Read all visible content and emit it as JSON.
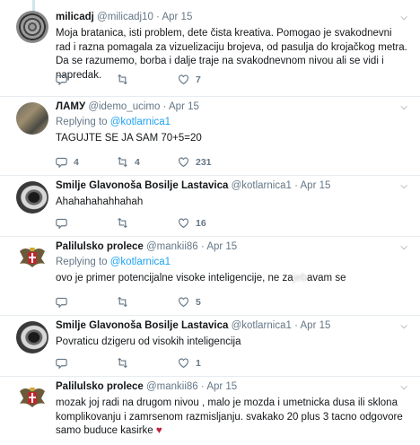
{
  "tweets": [
    {
      "name": "milicadj",
      "handle": "@milicadj10",
      "time": "Apr 15",
      "text": "Moja bratanica, isti problem, dete čista kreativa. Pomogao je svakodnevni rad i razna pomagala za vizuelizaciju brojeva, od pasulja do krojačkog metra. Da se razumemo, borba i dalje traje na svakodnevnom nivou ali se vidi i napredak.",
      "reply": "",
      "retweet": "",
      "like": "7"
    },
    {
      "name": "ЛАМУ",
      "handle": "@idemo_ucimo",
      "time": "Apr 15",
      "replying_label": "Replying to",
      "replying_to": "@kotlarnica1",
      "text": "TAGUJTE SE JA SAM 70+5=20",
      "reply": "4",
      "retweet": "4",
      "like": "231"
    },
    {
      "name": "Smilje Glavonoša Bosilje Lastavica",
      "handle": "@kotlarnica1",
      "time": "Apr 15",
      "text": "Ahahahahahhahah",
      "reply": "",
      "retweet": "",
      "like": "16"
    },
    {
      "name": "Palilulsko prolece",
      "handle": "@mankii86",
      "time": "Apr 15",
      "replying_label": "Replying to",
      "replying_to": "@kotlarnica1",
      "text_before": "ovo je primer potencijalne visoke inteligencije, ne za",
      "text_blur": "jeb",
      "text_after": "avam se",
      "reply": "",
      "retweet": "",
      "like": "5"
    },
    {
      "name": "Smilje Glavonoša Bosilje Lastavica",
      "handle": "@kotlarnica1",
      "time": "Apr 15",
      "text": "Povraticu dzigeru od visokih inteligencija",
      "reply": "",
      "retweet": "",
      "like": "1"
    },
    {
      "name": "Palilulsko prolece",
      "handle": "@mankii86",
      "time": "Apr 15",
      "text": "mozak joj radi na drugom nivou , malo je mozda i umetnicka dusa ili sklona komplikovanju i zamrsenom razmisljanju. svakako 20 plus 3 tacno odgovore samo buduce kasirke",
      "heart": "♥"
    }
  ],
  "colors": {
    "accent": "#1da1f2",
    "muted": "#657786",
    "thread": "#cfe5ec",
    "heart": "#e0245e"
  },
  "icons": [
    "reply-icon",
    "retweet-icon",
    "like-icon",
    "caret-down-icon"
  ]
}
